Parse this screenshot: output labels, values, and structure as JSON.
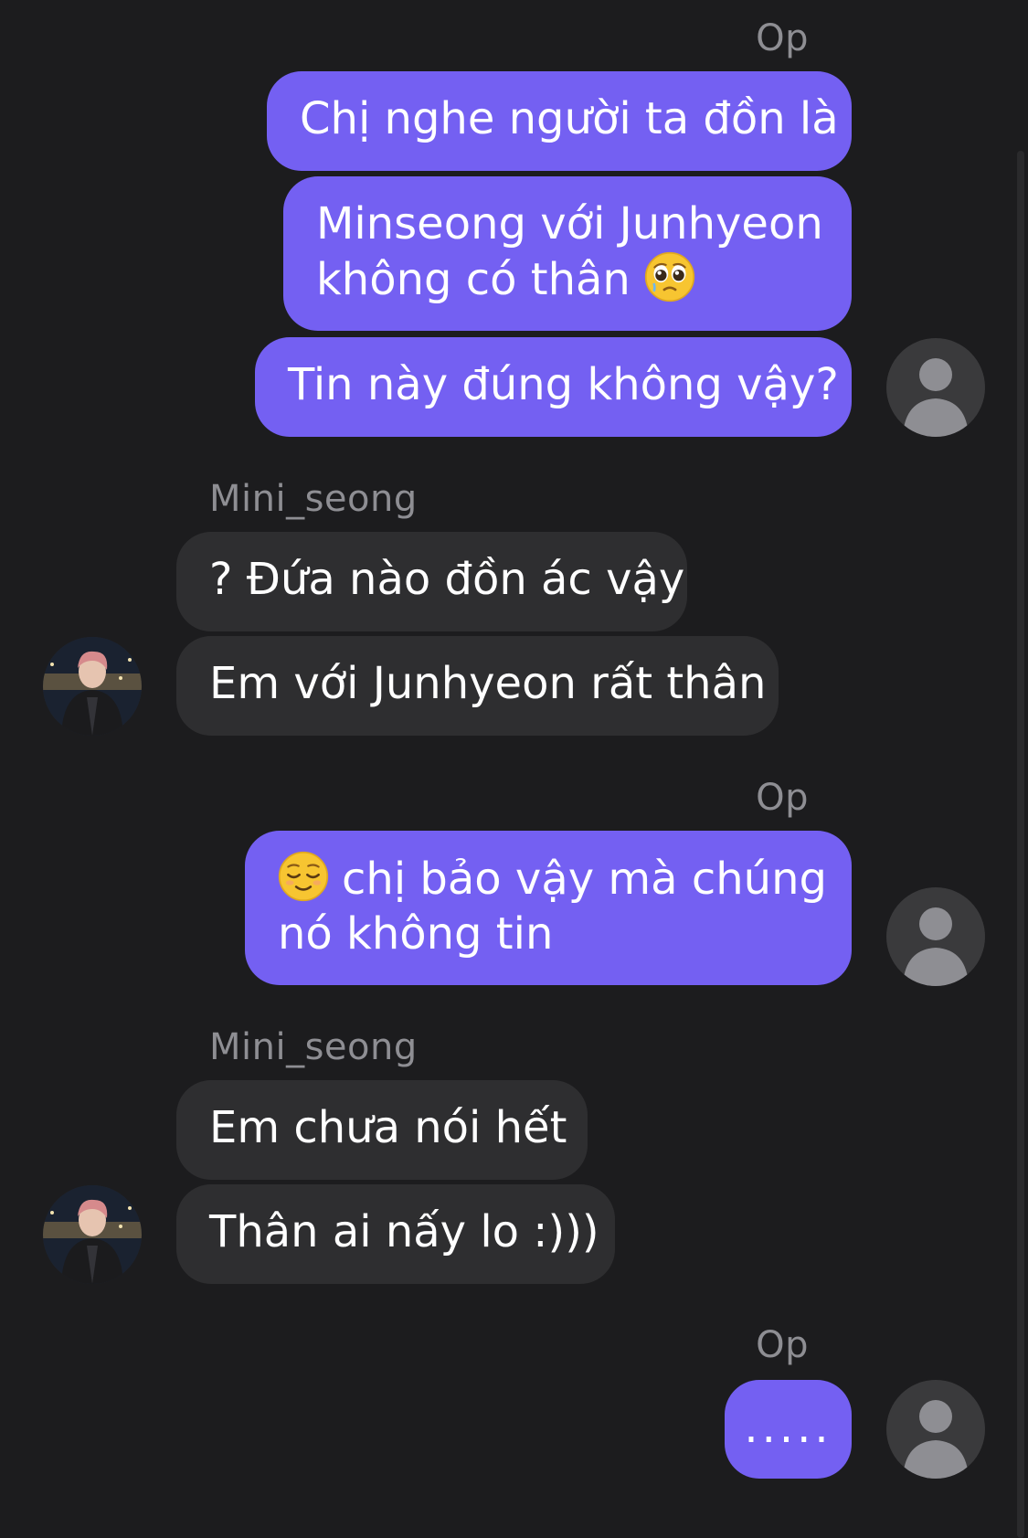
{
  "groups": {
    "g1": {
      "sender": "Op",
      "messages": [
        "Chị nghe người ta đồn là",
        "Minseong với Junhyeon\nkhông có thân",
        "Tin này đúng không vậy?"
      ]
    },
    "g2": {
      "sender": "Mini_seong",
      "messages": [
        "? Đứa nào đồn ác vậy",
        "Em với Junhyeon rất thân"
      ]
    },
    "g3": {
      "sender": "Op",
      "messages": [
        "chị bảo vậy mà chúng\nnó không tin"
      ]
    },
    "g4": {
      "sender": "Mini_seong",
      "messages": [
        "Em chưa nói hết",
        "Thân ai nấy lo :)))"
      ]
    },
    "g5": {
      "sender": "Op",
      "messages": [
        "....."
      ]
    }
  },
  "icons": {
    "pleading": "pleading-face-emoji",
    "relieved": "relieved-face-emoji",
    "default_avatar": "person-icon"
  },
  "colors": {
    "outgoing_bubble": "#7460f2",
    "incoming_bubble": "#2e2e30",
    "background": "#1c1c1e",
    "sender_name": "#8e8e93"
  }
}
